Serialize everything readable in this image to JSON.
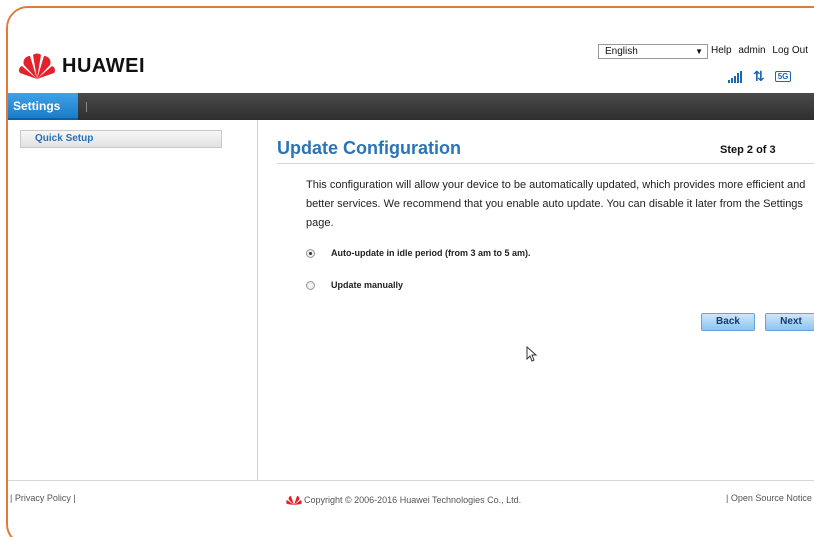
{
  "brand": {
    "name": "HUAWEI",
    "color": "#e3232b"
  },
  "header": {
    "language": "English",
    "links": [
      "Help",
      "admin",
      "Log Out"
    ],
    "network_badge": "5G"
  },
  "nav": {
    "active_tab": "Settings"
  },
  "sidebar": {
    "items": [
      {
        "label": "Quick Setup"
      }
    ]
  },
  "main": {
    "title": "Update Configuration",
    "step": "Step 2 of 3",
    "description": "This configuration will allow your device to be automatically updated, which provides more efficient and better services. We recommend that you enable auto update. You can disable it later from the Settings page.",
    "options": [
      {
        "label": "Auto-update in idle period (from 3 am to 5 am).",
        "checked": true
      },
      {
        "label": "Update manually",
        "checked": false
      }
    ],
    "back_label": "Back",
    "next_label": "Next"
  },
  "footer": {
    "privacy": "Privacy Policy",
    "copyright": "Copyright © 2006-2016 Huawei Technologies Co., Ltd.",
    "open_source": "Open Source Notice"
  },
  "colors": {
    "accent": "#2a74b8",
    "frame": "#e07a3a",
    "nav_active": "#1b7dc9"
  }
}
